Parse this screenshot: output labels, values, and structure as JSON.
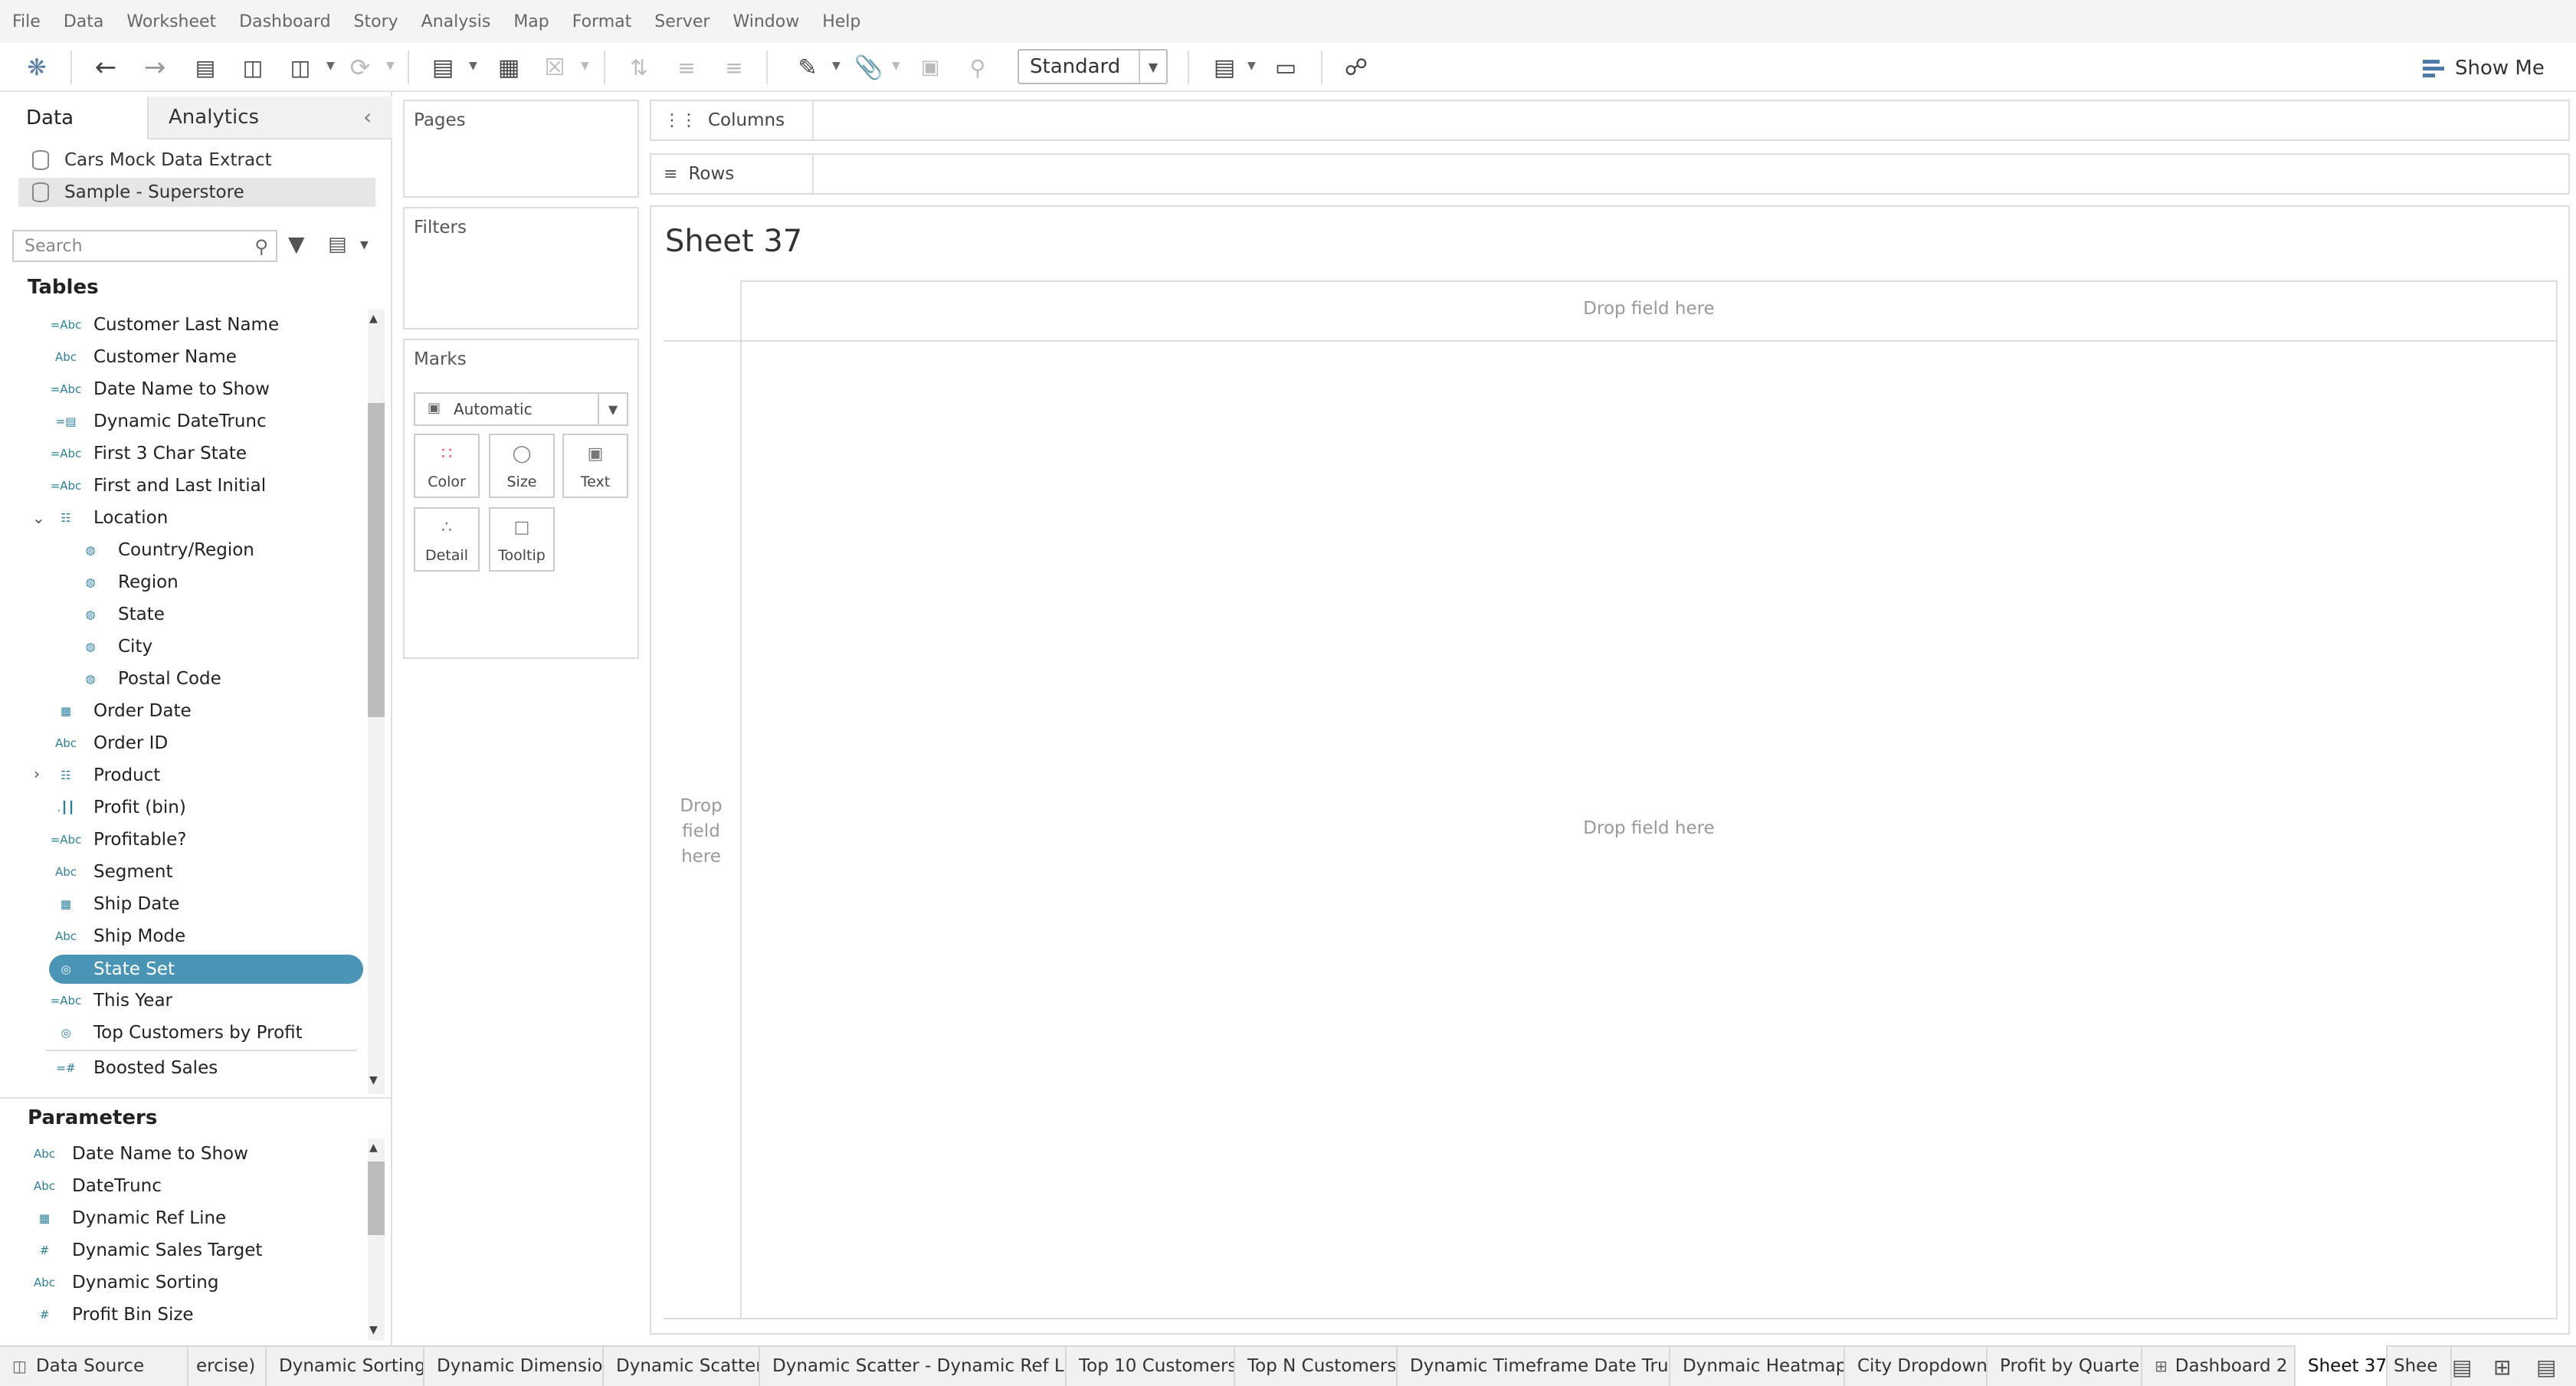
{
  "menu": [
    "File",
    "Data",
    "Worksheet",
    "Dashboard",
    "Story",
    "Analysis",
    "Map",
    "Format",
    "Server",
    "Window",
    "Help"
  ],
  "toolbar": {
    "fit_select": "Standard",
    "show_me": "Show Me"
  },
  "left": {
    "tab_data": "Data",
    "tab_analytics": "Analytics",
    "datasources": [
      "Cars Mock Data Extract",
      "Sample - Superstore"
    ],
    "search_placeholder": "Search",
    "tables_header": "Tables",
    "fields": [
      {
        "icon": "=Abc",
        "label": "Customer Last Name"
      },
      {
        "icon": "Abc",
        "label": "Customer Name"
      },
      {
        "icon": "=Abc",
        "label": "Date Name to Show"
      },
      {
        "icon": "=▤",
        "label": "Dynamic DateTrunc"
      },
      {
        "icon": "=Abc",
        "label": "First 3 Char State"
      },
      {
        "icon": "=Abc",
        "label": "First and Last Initial"
      },
      {
        "icon": "☷",
        "label": "Location"
      },
      {
        "icon": "◍",
        "label": "Country/Region"
      },
      {
        "icon": "◍",
        "label": "Region"
      },
      {
        "icon": "◍",
        "label": "State"
      },
      {
        "icon": "◍",
        "label": "City"
      },
      {
        "icon": "◍",
        "label": "Postal Code"
      },
      {
        "icon": "▦",
        "label": "Order Date"
      },
      {
        "icon": "Abc",
        "label": "Order ID"
      },
      {
        "icon": "☷",
        "label": "Product"
      },
      {
        "icon": ".┃┃",
        "label": "Profit (bin)"
      },
      {
        "icon": "=Abc",
        "label": "Profitable?"
      },
      {
        "icon": "Abc",
        "label": "Segment"
      },
      {
        "icon": "▦",
        "label": "Ship Date"
      },
      {
        "icon": "Abc",
        "label": "Ship Mode"
      },
      {
        "icon": "◎",
        "label": "State Set"
      },
      {
        "icon": "=Abc",
        "label": "This Year"
      },
      {
        "icon": "◎",
        "label": "Top Customers by Profit"
      },
      {
        "icon": "=#",
        "label": "Boosted Sales"
      }
    ],
    "parameters_header": "Parameters",
    "parameters": [
      {
        "icon": "Abc",
        "label": "Date Name to Show"
      },
      {
        "icon": "Abc",
        "label": "DateTrunc"
      },
      {
        "icon": "▦",
        "label": "Dynamic Ref Line"
      },
      {
        "icon": "#",
        "label": "Dynamic Sales Target"
      },
      {
        "icon": "Abc",
        "label": "Dynamic Sorting"
      },
      {
        "icon": "#",
        "label": "Profit Bin Size"
      }
    ]
  },
  "cards": {
    "pages": "Pages",
    "filters": "Filters",
    "marks": "Marks",
    "mark_type": "Automatic",
    "mark_buttons": [
      "Color",
      "Size",
      "Text",
      "Detail",
      "Tooltip"
    ]
  },
  "shelves": {
    "columns": "Columns",
    "rows": "Rows"
  },
  "viz": {
    "title": "Sheet 37",
    "drop_top": "Drop field here",
    "drop_center": "Drop field here",
    "drop_left": "Drop field here"
  },
  "tabs": [
    "Data Source",
    "ercise)",
    "Dynamic Sorting",
    "Dynamic Dimension",
    "Dynamic Scatter",
    "Dynamic Scatter - Dynamic Ref Lines",
    "Top 10 Customers",
    "Top N Customers",
    "Dynamic Timeframe Date Trunc",
    "Dynmaic Heatmap",
    "City Dropdown",
    "Profit by Quarter",
    "Dashboard 2",
    "Sheet 37",
    "Shee"
  ]
}
